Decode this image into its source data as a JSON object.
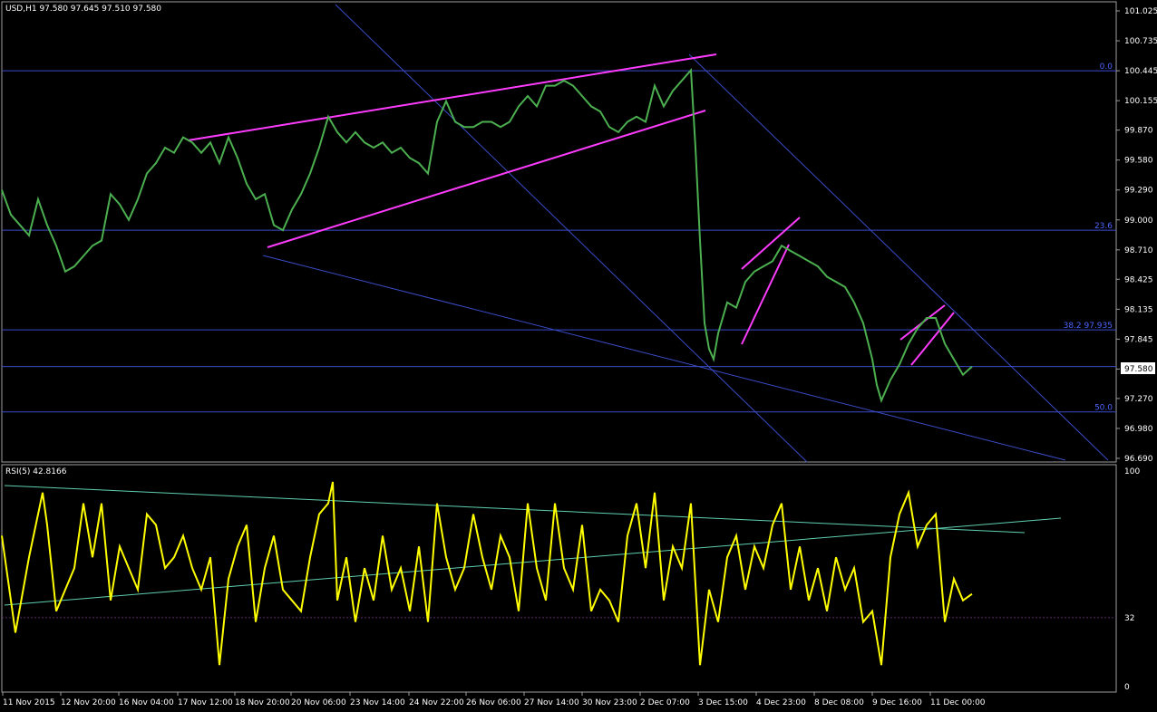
{
  "main_pane": {
    "symbol_info": "USD,H1  97.580 97.645 97.510 97.580",
    "current_price_label": "97.580"
  },
  "rsi_pane": {
    "title": "RSI(5) 42.8166"
  },
  "chart_data": [
    {
      "type": "line",
      "pane": "price",
      "title": "USD,H1",
      "ohlc": {
        "open": 97.58,
        "high": 97.645,
        "low": 97.51,
        "close": 97.58
      },
      "y_ticks": [
        "101.025",
        "100.735",
        "100.445",
        "100.155",
        "99.870",
        "99.580",
        "99.290",
        "99.000",
        "98.710",
        "98.425",
        "98.135",
        "97.845",
        "97.555",
        "97.270",
        "96.980",
        "96.690"
      ],
      "ylim": [
        96.69,
        101.025
      ],
      "current_price": 97.58,
      "fib_levels": [
        {
          "label": "0.0",
          "value": 100.445
        },
        {
          "label": "23.6",
          "value": 98.9
        },
        {
          "label": "38.2 97.935",
          "value": 97.935
        },
        {
          "label": "50.0",
          "value": 97.14
        }
      ],
      "x_ticks": [
        "11 Nov 2015",
        "12 Nov 20:00",
        "16 Nov 04:00",
        "17 Nov 12:00",
        "18 Nov 20:00",
        "20 Nov 06:00",
        "23 Nov 14:00",
        "24 Nov 22:00",
        "26 Nov 06:00",
        "27 Nov 14:00",
        "30 Nov 23:00",
        "2 Dec 07:00",
        "3 Dec 15:00",
        "4 Dec 23:00",
        "8 Dec 08:00",
        "9 Dec 16:00",
        "11 Dec 00:00"
      ],
      "series": [
        {
          "color": "#4caf50",
          "x": [
            0,
            10,
            20,
            30,
            40,
            50,
            60,
            70,
            80,
            90,
            100,
            110,
            120,
            130,
            140,
            150,
            160,
            170,
            180,
            190,
            200,
            210,
            220,
            230,
            240,
            250,
            260,
            270,
            280,
            290,
            300,
            310,
            320,
            330,
            340,
            350,
            360,
            370,
            380,
            390,
            400,
            410,
            420,
            430,
            440,
            450,
            460,
            470,
            480,
            490,
            500,
            510,
            520,
            530,
            540,
            550,
            560,
            570,
            580,
            590,
            600,
            610,
            620,
            630,
            640,
            650,
            660,
            670,
            680,
            690,
            700,
            710,
            720,
            730,
            740,
            750,
            760,
            765,
            770,
            775,
            780,
            785,
            790,
            800,
            810,
            820,
            830,
            840,
            850,
            860,
            870,
            880,
            890,
            900,
            910,
            920,
            930,
            940,
            950,
            960,
            965,
            970,
            980,
            990,
            1000,
            1010,
            1020,
            1030,
            1040,
            1050,
            1060,
            1070
          ],
          "values": [
            99.29,
            99.05,
            98.95,
            98.85,
            99.2,
            98.95,
            98.75,
            98.5,
            98.55,
            98.65,
            98.75,
            98.8,
            99.25,
            99.15,
            99.0,
            99.2,
            99.45,
            99.55,
            99.7,
            99.65,
            99.8,
            99.75,
            99.65,
            99.75,
            99.55,
            99.8,
            99.6,
            99.35,
            99.2,
            99.25,
            98.95,
            98.9,
            99.1,
            99.25,
            99.45,
            99.7,
            100.0,
            99.85,
            99.75,
            99.85,
            99.75,
            99.7,
            99.75,
            99.65,
            99.7,
            99.6,
            99.55,
            99.45,
            99.95,
            100.15,
            99.95,
            99.9,
            99.9,
            99.95,
            99.95,
            99.9,
            99.95,
            100.1,
            100.2,
            100.1,
            100.3,
            100.3,
            100.35,
            100.3,
            100.2,
            100.1,
            100.05,
            99.9,
            99.85,
            99.95,
            100.0,
            99.95,
            100.3,
            100.1,
            100.25,
            100.35,
            100.45,
            99.7,
            98.8,
            98.0,
            97.75,
            97.65,
            97.9,
            98.2,
            98.15,
            98.4,
            98.5,
            98.55,
            98.6,
            98.75,
            98.7,
            98.65,
            98.6,
            98.55,
            98.45,
            98.4,
            98.35,
            98.2,
            98.0,
            97.65,
            97.4,
            97.25,
            97.45,
            97.6,
            97.8,
            97.95,
            98.05,
            98.05,
            97.8,
            97.65,
            97.5,
            97.58
          ]
        }
      ],
      "trendlines": "magenta channel and wedge lines, blue descending channel lines"
    },
    {
      "type": "line",
      "pane": "rsi",
      "title": "RSI(5) 42.8166",
      "y_ticks": [
        "100",
        "32",
        "0"
      ],
      "ylim": [
        0,
        100
      ],
      "level": 32,
      "series": [
        {
          "color": "#ffff00",
          "x": [
            0,
            15,
            30,
            45,
            50,
            60,
            70,
            80,
            90,
            100,
            110,
            120,
            130,
            140,
            150,
            160,
            170,
            180,
            190,
            200,
            210,
            220,
            230,
            240,
            250,
            260,
            270,
            280,
            290,
            300,
            310,
            320,
            330,
            340,
            350,
            360,
            365,
            370,
            380,
            390,
            400,
            410,
            420,
            430,
            440,
            450,
            460,
            470,
            480,
            490,
            500,
            510,
            520,
            530,
            540,
            550,
            560,
            570,
            580,
            590,
            600,
            610,
            620,
            630,
            640,
            650,
            660,
            670,
            680,
            690,
            700,
            710,
            720,
            730,
            740,
            750,
            760,
            770,
            780,
            790,
            800,
            810,
            820,
            830,
            840,
            850,
            860,
            870,
            880,
            890,
            900,
            910,
            920,
            930,
            940,
            950,
            960,
            970,
            980,
            990,
            1000,
            1010,
            1020,
            1030,
            1040,
            1050,
            1060,
            1070
          ],
          "values": [
            70,
            25,
            60,
            90,
            75,
            35,
            45,
            55,
            85,
            60,
            85,
            40,
            65,
            55,
            45,
            80,
            75,
            55,
            60,
            70,
            55,
            45,
            60,
            10,
            50,
            65,
            75,
            30,
            55,
            70,
            45,
            40,
            35,
            60,
            80,
            85,
            95,
            40,
            60,
            30,
            55,
            40,
            70,
            45,
            55,
            35,
            65,
            30,
            85,
            60,
            45,
            55,
            80,
            60,
            45,
            70,
            60,
            35,
            85,
            55,
            40,
            85,
            55,
            45,
            75,
            35,
            45,
            40,
            30,
            70,
            85,
            55,
            90,
            40,
            65,
            55,
            85,
            10,
            45,
            30,
            60,
            70,
            45,
            65,
            55,
            75,
            85,
            45,
            65,
            40,
            55,
            35,
            60,
            45,
            55,
            30,
            35,
            10,
            60,
            80,
            90,
            65,
            75,
            80,
            30,
            50,
            40,
            43
          ]
        }
      ],
      "trendlines": "cyan upper and lower lines"
    }
  ]
}
